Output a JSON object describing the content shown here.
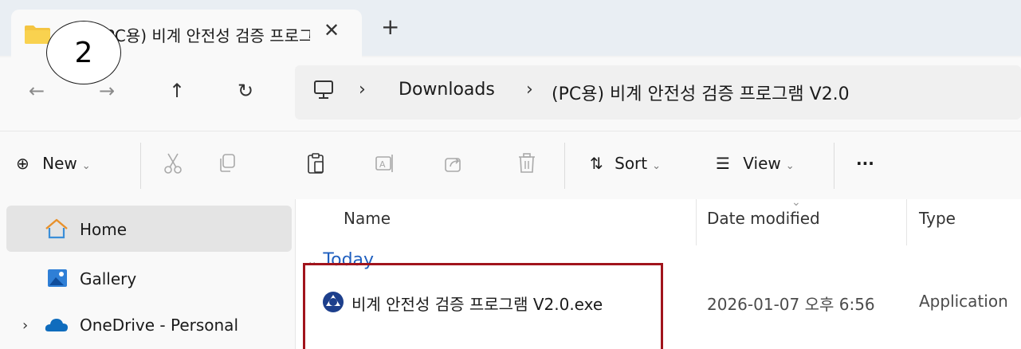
{
  "tab": {
    "title": "(PC용) 비계 안전성 검증 프로그",
    "close": "✕",
    "new_tab": "+"
  },
  "step_marker": "2",
  "nav": {
    "back": "←",
    "forward": "→",
    "up": "↑",
    "refresh": "↻"
  },
  "address": {
    "sep1": "›",
    "crumb1": "Downloads",
    "sep2": "›",
    "crumb2": "(PC용) 비계 안전성 검증 프로그램 V2.0"
  },
  "toolbar": {
    "new_label": "New",
    "sort_label": "Sort",
    "view_label": "View",
    "more_label": "···",
    "caret": "⌄"
  },
  "sidebar": {
    "items": [
      {
        "label": "Home"
      },
      {
        "label": "Gallery"
      },
      {
        "label": "OneDrive - Personal",
        "expander": "›"
      }
    ]
  },
  "columns": {
    "name": "Name",
    "date": "Date modified",
    "type": "Type",
    "sort_caret": "⌄"
  },
  "group": {
    "label": "Today"
  },
  "files": [
    {
      "name": "비계 안전성 검증 프로그램 V2.0.exe",
      "date": "2026-01-07 오후 6:56",
      "type": "Application"
    }
  ],
  "colors": {
    "accent": "#1f5fbf",
    "highlight": "#a1141c",
    "folder": "#f4c542",
    "onedrive": "#0f6cbd"
  }
}
